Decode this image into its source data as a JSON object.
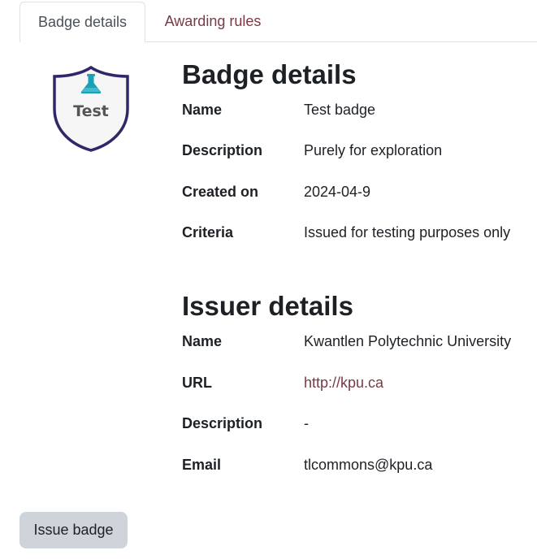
{
  "tabs": [
    {
      "label": "Badge details",
      "active": true
    },
    {
      "label": "Awarding rules",
      "active": false
    }
  ],
  "badge": {
    "image_text": "Test",
    "icon": "flask-icon",
    "colors": {
      "outline": "#2f2868",
      "flask": "#17a2b8",
      "text": "#555555"
    }
  },
  "badge_details": {
    "title": "Badge details",
    "rows": [
      {
        "label": "Name",
        "value": "Test badge"
      },
      {
        "label": "Description",
        "value": "Purely for exploration"
      },
      {
        "label": "Created on",
        "value": "2024-04-9"
      },
      {
        "label": "Criteria",
        "value": "Issued for testing purposes only"
      }
    ]
  },
  "issuer_details": {
    "title": "Issuer details",
    "rows": [
      {
        "label": "Name",
        "value": "Kwantlen Polytechnic University"
      },
      {
        "label": "URL",
        "value": "http://kpu.ca"
      },
      {
        "label": "Description",
        "value": "-"
      },
      {
        "label": "Email",
        "value": "tlcommons@kpu.ca"
      }
    ]
  },
  "actions": {
    "issue_badge_label": "Issue badge"
  },
  "colors": {
    "link": "#7a3a44",
    "button_bg": "#ced4da"
  }
}
